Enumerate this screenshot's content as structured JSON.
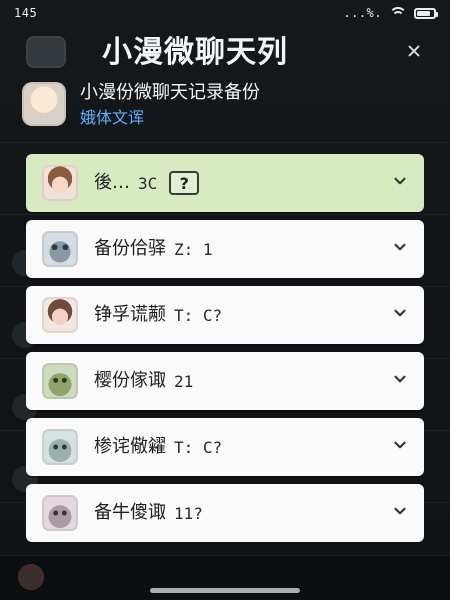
{
  "status_bar": {
    "time": "145",
    "extra": "...%."
  },
  "header": {
    "title": "小漫微聊天列",
    "backup_title": "小漫份微聊天记录备份",
    "backup_link": "娥体文诨"
  },
  "items": [
    {
      "label": "後…",
      "meta": "3C",
      "help": "?"
    },
    {
      "label": "备份佮驿",
      "meta": "Z: 1"
    },
    {
      "label": "铮孚谎颟",
      "meta": "T: C?"
    },
    {
      "label": "樱份傢诹",
      "meta": "21"
    },
    {
      "label": "椮诧儆糴",
      "meta": "T: C?"
    },
    {
      "label": "备牛傻诹",
      "meta": "11?"
    }
  ],
  "icons": {
    "wifi": "wifi-icon",
    "battery": "battery-icon",
    "close": "close-icon",
    "chevron": "chevron-down-icon"
  },
  "colors": {
    "background": "#0f1214",
    "highlight_card": "#d9eac2",
    "link": "#5fb1ff"
  }
}
